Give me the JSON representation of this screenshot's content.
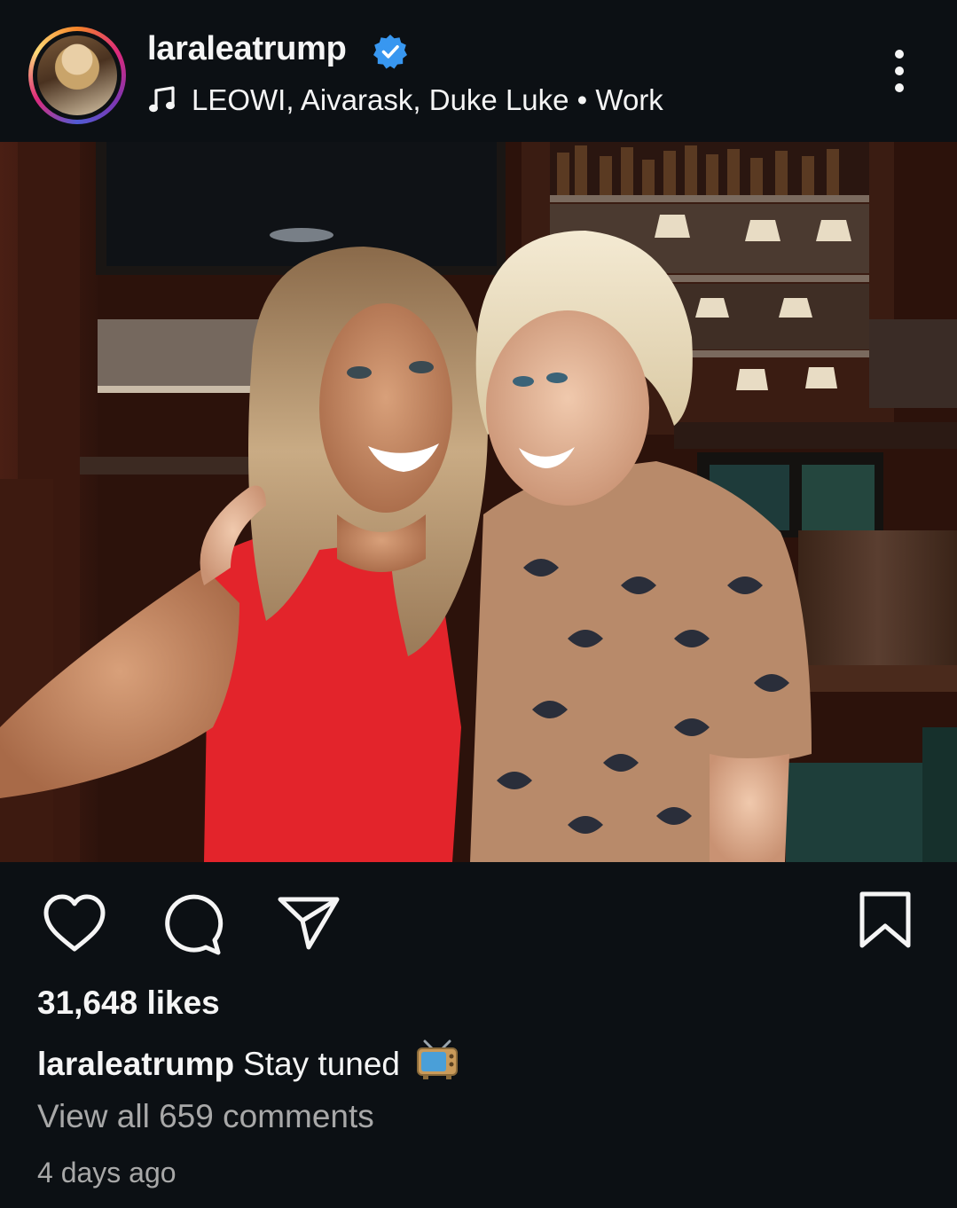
{
  "post": {
    "username": "laraleatrump",
    "verified": true,
    "audio": "LEOWI, Aivarask, Duke Luke • Work",
    "likes": "31,648 likes",
    "caption_user": "laraleatrump",
    "caption_text": "Stay tuned",
    "caption_emoji": "tv-icon",
    "view_comments": "View all 659 comments",
    "timestamp": "4 days ago"
  },
  "colors": {
    "background": "#0c1014",
    "text": "#f5f5f5",
    "secondary_text": "#a8a8a8",
    "verified_blue": "#3897f0",
    "dress_red": "#e3242b"
  },
  "icons": {
    "header": [
      "verified-badge-icon",
      "music-note-icon",
      "more-options-icon"
    ],
    "overlay": [
      "person-tag-icon",
      "mute-icon"
    ],
    "actions": [
      "heart-icon",
      "comment-icon",
      "share-icon",
      "bookmark-icon"
    ]
  }
}
